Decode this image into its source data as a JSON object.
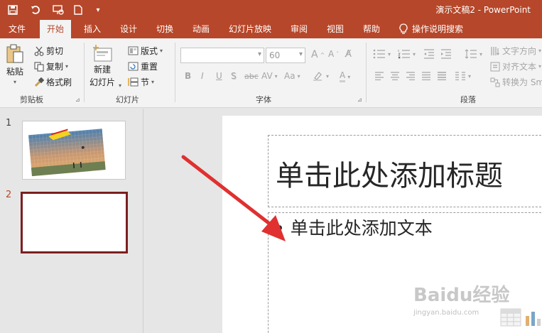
{
  "window": {
    "title": "演示文稿2  -  PowerPoint"
  },
  "tabs": [
    "文件",
    "开始",
    "插入",
    "设计",
    "切换",
    "动画",
    "幻灯片放映",
    "审阅",
    "视图",
    "帮助"
  ],
  "active_tab": "开始",
  "tell_me": "操作说明搜索",
  "clipboard": {
    "paste": "粘贴",
    "cut": "剪切",
    "copy": "复制",
    "format_painter": "格式刷",
    "group": "剪贴板"
  },
  "slides_group": {
    "new_slide_line1": "新建",
    "new_slide_line2": "幻灯片",
    "layout": "版式",
    "reset": "重置",
    "section": "节",
    "group": "幻灯片"
  },
  "font_group": {
    "font_name": "",
    "font_size": "60",
    "group": "字体",
    "buttons": [
      "B",
      "I",
      "U",
      "S",
      "abc",
      "AV",
      "Aa",
      "A"
    ]
  },
  "paragraph_group": {
    "text_direction": "文字方向",
    "align_text": "对齐文本",
    "convert": "转换为 Sm",
    "group": "段落"
  },
  "thumbnails": {
    "slide1": "1",
    "slide2": "2"
  },
  "slide": {
    "title_placeholder": "单击此处添加标题",
    "body_placeholder": "单击此处添加文本",
    "bullet": "•"
  },
  "watermark": {
    "brand": "Baidu经验",
    "url": "jingyan.baidu.com"
  },
  "colors": {
    "accent": "#b7472a",
    "selection": "#7b1f1f"
  }
}
